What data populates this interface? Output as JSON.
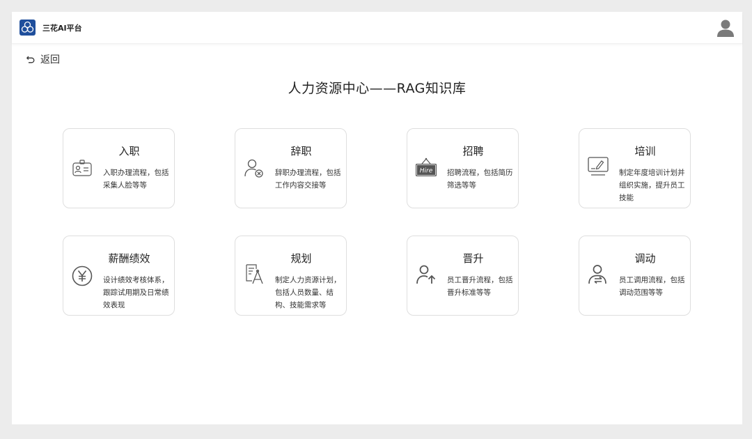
{
  "header": {
    "app_title": "三花AI平台"
  },
  "nav": {
    "back_label": "返回"
  },
  "page": {
    "title": "人力资源中心——RAG知识库"
  },
  "cards": [
    {
      "title": "入职",
      "desc": "入职办理流程，包括采集人脸等等",
      "icon": "id-badge-icon"
    },
    {
      "title": "辞职",
      "desc": "辞职办理流程，包括工作内容交接等",
      "icon": "user-remove-icon"
    },
    {
      "title": "招聘",
      "desc": "招聘流程，包括简历筛选等等",
      "icon": "hire-sign-icon",
      "icon_text": "Hire"
    },
    {
      "title": "培训",
      "desc": "制定年度培训计划并组织实施，提升员工技能",
      "icon": "training-board-icon"
    },
    {
      "title": "薪酬绩效",
      "desc": "设计绩效考核体系，跟踪试用期及日常绩效表现",
      "icon": "yen-icon"
    },
    {
      "title": "规划",
      "desc": "制定人力资源计划，包括人员数量、结构、技能需求等",
      "icon": "planning-icon"
    },
    {
      "title": "晋升",
      "desc": "员工晋升流程，包括晋升标准等等",
      "icon": "user-up-icon"
    },
    {
      "title": "调动",
      "desc": "员工调用流程，包括调动范围等等",
      "icon": "user-transfer-icon"
    }
  ],
  "colors": {
    "brand": "#1f4f9c",
    "background": "#ececec",
    "card_border": "#dedede"
  }
}
